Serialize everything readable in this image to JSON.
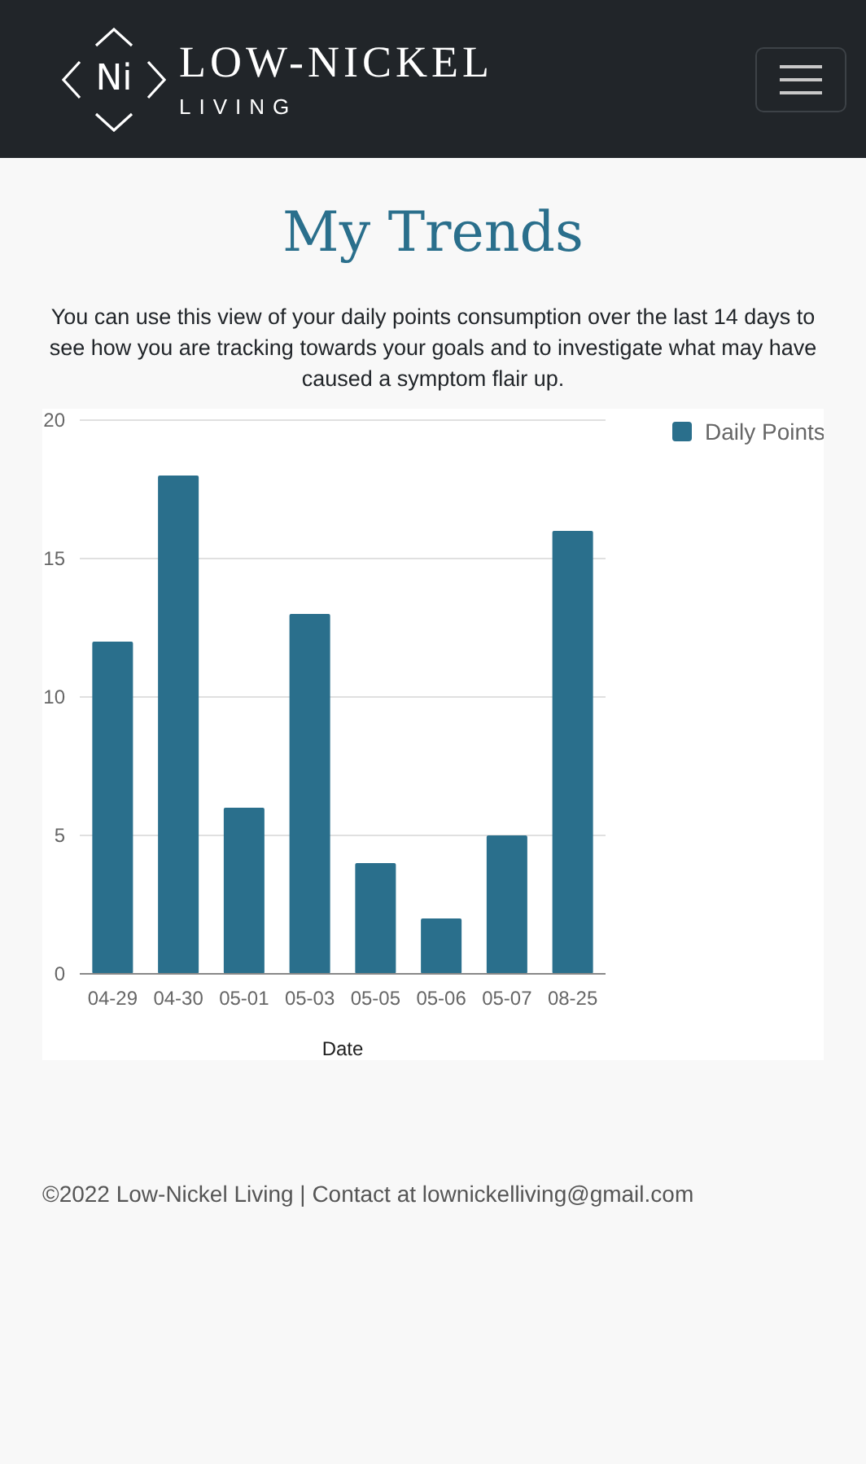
{
  "navbar": {
    "logo_mark": "Ni",
    "brand_title": "LOW-NICKEL",
    "brand_subtitle": "LIVING",
    "menu_expanded": false
  },
  "page": {
    "title": "My Trends",
    "intro": "You can use this view of your daily points consumption over the last 14 days to see how you are tracking towards your goals and to investigate what may have caused a symptom flair up."
  },
  "chart": {
    "chart_data": {
      "type": "bar",
      "xlabel": "Date",
      "categories": [
        "04-29",
        "04-30",
        "05-01",
        "05-03",
        "05-05",
        "05-06",
        "05-07",
        "08-25"
      ],
      "series": [
        {
          "name": "Daily Points",
          "color": "#2a6f8c",
          "values": [
            12,
            18,
            6,
            13,
            4,
            2,
            5,
            16
          ]
        }
      ],
      "ylim": [
        0,
        20
      ],
      "grid": true,
      "yticks": [
        0,
        5,
        10,
        15,
        20
      ]
    }
  },
  "footer": {
    "text": "©2022 Low-Nickel Living | Contact at lownickelliving@gmail.com"
  }
}
